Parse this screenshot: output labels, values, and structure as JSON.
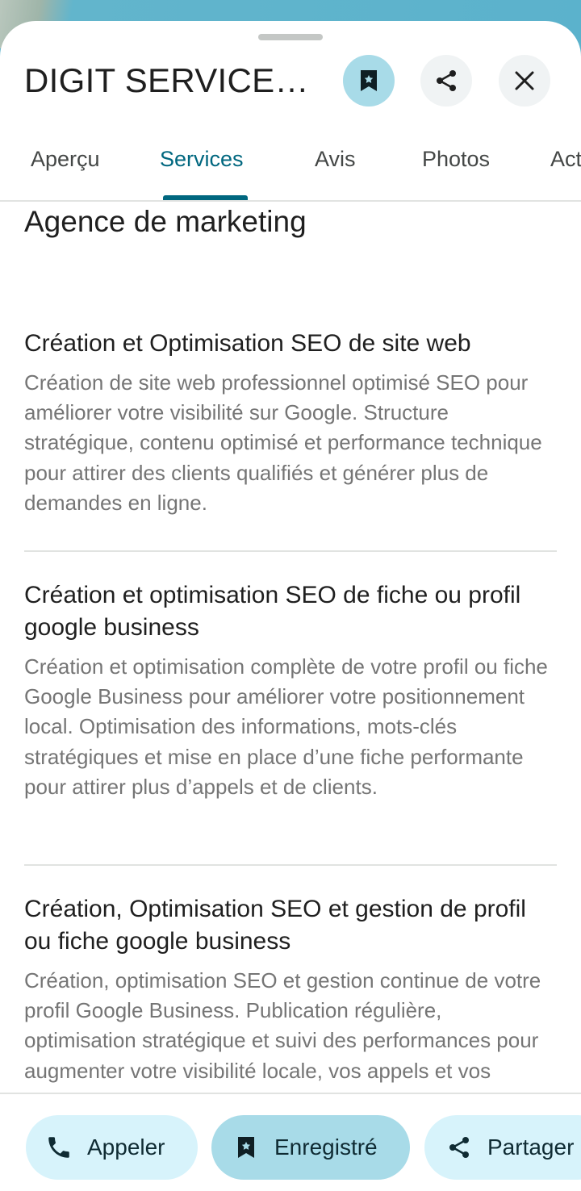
{
  "header": {
    "title": "DIGIT SERVICES..."
  },
  "tabs": [
    {
      "label": "Aperçu",
      "active": false
    },
    {
      "label": "Services",
      "active": true
    },
    {
      "label": "Avis",
      "active": false
    },
    {
      "label": "Photos",
      "active": false
    },
    {
      "label": "Actualités",
      "active": false
    }
  ],
  "content": {
    "category": "Agence de marketing",
    "services": [
      {
        "name": "Création et Optimisation SEO de site web",
        "description": "Création de site web professionnel optimisé SEO pour améliorer votre visibilité sur Google. Structure stratégique, contenu optimisé et performance technique pour attirer des clients qualifiés et générer plus de demandes en ligne."
      },
      {
        "name": "Création et optimisation SEO de fiche ou profil google business",
        "description": "Création et optimisation complète de votre profil ou fiche Google Business pour améliorer votre positionnement local. Optimisation des informations, mots-clés stratégiques et mise en place d’une fiche performante pour attirer plus d’appels et de clients."
      },
      {
        "name": "Création, Optimisation SEO et gestion de profil ou fiche google business",
        "description": "Création, optimisation SEO et gestion continue de votre profil Google Business. Publication régulière, optimisation stratégique et suivi des performances pour augmenter votre visibilité locale, vos appels et vos demandes clients."
      }
    ]
  },
  "actions": {
    "call_label": "Appeler",
    "saved_label": "Enregistré",
    "share_label": "Partager"
  },
  "icons": {
    "save": "bookmark-icon",
    "share": "share-icon",
    "close": "close-icon",
    "call": "phone-icon"
  },
  "colors": {
    "accent": "#00677f",
    "saved_bg": "#a8dbe8",
    "pill_bg": "#d7f3fb"
  }
}
